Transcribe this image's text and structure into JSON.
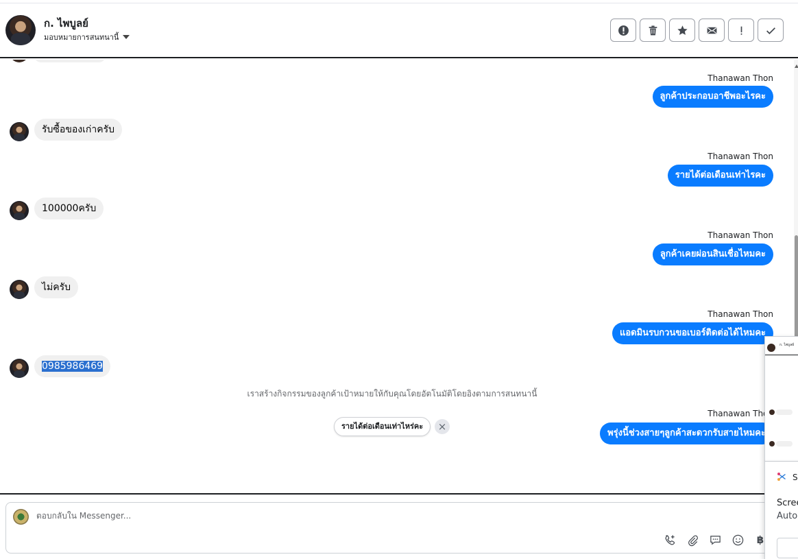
{
  "header": {
    "contact_name": "ก. ไพบูลย์",
    "assign_label": "มอบหมายการสนทนานี้",
    "actions": [
      {
        "name": "report-icon",
        "glyph": "!"
      },
      {
        "name": "trash-icon",
        "glyph": "🗑"
      },
      {
        "name": "star-icon",
        "glyph": "★"
      },
      {
        "name": "mail-icon",
        "glyph": "✉"
      },
      {
        "name": "exclamation-icon",
        "glyph": "!"
      },
      {
        "name": "check-icon",
        "glyph": "✓"
      }
    ]
  },
  "messages": {
    "out_1": {
      "sender": "Thanawan Thon",
      "text": "ลูกค้าประกอบอาชีพอะไรคะ"
    },
    "in_1": {
      "text": "รับซื้อของเก่าครับ"
    },
    "out_2": {
      "sender": "Thanawan Thon",
      "text": "รายได้ต่อเดือนเท่าไรคะ"
    },
    "in_2": {
      "text": "100000ครับ"
    },
    "out_3": {
      "sender": "Thanawan Thon",
      "text": "ลูกค้าเคยผ่อนสินเชื่อไหมคะ"
    },
    "in_3": {
      "text": "ไม่ครับ"
    },
    "out_4": {
      "sender": "Thanawan Thon",
      "text": "แอดมินรบกวนขอเบอร์ติดต่อได้ไหมคะ"
    },
    "in_4": {
      "text": "0985986469"
    },
    "out_5": {
      "sender": "Thanawan Thon",
      "text": "พรุ่งนี้ช่วงสายๆลูกค้าสะดวกรับสายไหมคะ"
    }
  },
  "system_note": "เราสร้างกิจกรรมของลูกค้าเป้าหมายให้กับคุณโดยอัตโนมัติโดยอิงตามการสนทนานี้",
  "suggestion_chip": "รายได้ต่อเดือนเท่าไหร่คะ",
  "composer": {
    "placeholder": "ตอบกลับใน Messenger...",
    "tools": [
      "phone-plus-icon",
      "paperclip-icon",
      "chat-bubble-icon",
      "emoji-icon",
      "baht-icon"
    ],
    "baht_symbol": "฿"
  },
  "overlay": {
    "thumbnail_name": "ก. ไพบูลย์",
    "snip_title": "Sn",
    "snip_line1": "Scree",
    "snip_line2": "Autor"
  }
}
